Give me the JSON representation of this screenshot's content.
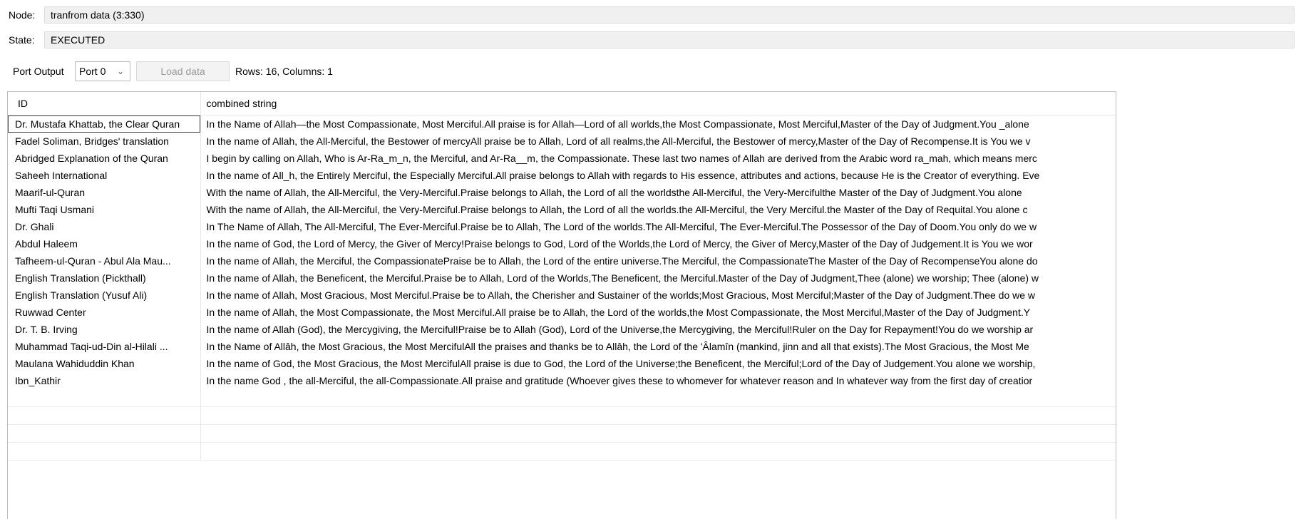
{
  "node": {
    "label": "Node:",
    "value": "tranfrom data  (3:330)"
  },
  "state": {
    "label": "State:",
    "value": "EXECUTED"
  },
  "toolbar": {
    "port_output_label": "Port Output",
    "port_selected": "Port 0",
    "load_button": "Load data",
    "rows_info": "Rows: 16, Columns: 1"
  },
  "table": {
    "headers": [
      "ID",
      "combined string"
    ],
    "rows": [
      {
        "id": "Dr. Mustafa Khattab, the Clear Quran",
        "text": "In the Name of Allah—the Most Compassionate, Most Merciful.All praise is for Allah—Lord of all worlds,the Most Compassionate, Most Merciful,Master of the Day of Judgment.You _alone"
      },
      {
        "id": "Fadel Soliman, Bridges' translation",
        "text": "In the name of Allah, the All-Merciful, the Bestower of mercyAll praise be to Allah, Lord of all realms,the All-Merciful, the Bestower of mercy,Master of the Day of Recompense.It is You we v"
      },
      {
        "id": "Abridged Explanation of the Quran",
        "text": "I begin by calling on Allah, Who is Ar-Ra_m_n, the Merciful, and Ar-Ra__m, the Compassionate. These last two names of Allah are derived from the Arabic word ra_mah, which means merc"
      },
      {
        "id": "Saheeh International",
        "text": "In the name of All_h, the Entirely Merciful, the Especially Merciful.All praise belongs to Allah with regards to His essence, attributes and actions, because He is the Creator of everything. Eve"
      },
      {
        "id": "Maarif-ul-Quran",
        "text": "With the name of Allah, the All-Merciful, the Very-Merciful.Praise belongs to Allah, the Lord of all the worldsthe All-Merciful, the Very-Mercifulthe Master of the Day of Judgment.You alone"
      },
      {
        "id": "Mufti Taqi Usmani",
        "text": "With the name of Allah, the All-Merciful, the Very-Merciful.Praise belongs to Allah, the Lord of all the worlds.the All-Merciful, the Very Merciful.the Master of the Day of Requital.You alone c"
      },
      {
        "id": "Dr. Ghali",
        "text": "In The Name of Allah, The All-Merciful, The Ever-Merciful.Praise be to Allah, The Lord of the worlds.The All-Merciful, The Ever-Merciful.The Possessor of the Day of Doom.You only do we w"
      },
      {
        "id": "Abdul Haleem",
        "text": "In the name of God, the Lord of Mercy, the Giver of Mercy!Praise belongs to God, Lord of the Worlds,the Lord of Mercy, the Giver of Mercy,Master of the Day of Judgement.It is You we wor"
      },
      {
        "id": "Tafheem-ul-Quran - Abul Ala Mau...",
        "text": "In the name of Allah, the Merciful, the CompassionatePraise be to Allah, the Lord of the entire universe.The Merciful, the CompassionateThe Master of the Day of RecompenseYou alone do"
      },
      {
        "id": "English Translation (Pickthall)",
        "text": "In the name of Allah, the Beneficent, the Merciful.Praise be to Allah, Lord of the Worlds,The Beneficent, the Merciful.Master of the Day of Judgment,Thee (alone) we worship; Thee (alone) w"
      },
      {
        "id": "English Translation (Yusuf Ali)",
        "text": "In the name of Allah, Most Gracious, Most Merciful.Praise be to Allah, the Cherisher and Sustainer of the worlds;Most Gracious, Most Merciful;Master of the Day of Judgment.Thee do we w"
      },
      {
        "id": "Ruwwad Center",
        "text": "In the name of Allah, the Most Compassionate, the Most Merciful.All praise be to Allah, the Lord of the worlds,the Most Compassionate, the Most Merciful,Master of the Day of Judgment.Y"
      },
      {
        "id": "Dr. T. B. Irving",
        "text": "In the name of Allah (God), the Mercygiving, the Merciful!Praise be to Allah (God), Lord of the Universe,the Mercygiving, the Merciful!Ruler on the Day for Repayment!You do we worship ar"
      },
      {
        "id": "Muhammad Taqi-ud-Din al-Hilali ...",
        "text": "In the Name of Allâh, the Most Gracious, the Most MercifulAll the praises and thanks be to Allâh, the Lord of the 'Âlamîn (mankind, jinn and all that exists).The Most Gracious, the Most Me"
      },
      {
        "id": "Maulana Wahiduddin Khan",
        "text": "In the name of God, the Most Gracious, the Most MercifulAll praise is due to God, the Lord of the Universe;the Beneficent, the Merciful;Lord of the Day of Judgement.You alone we worship,"
      },
      {
        "id": "Ibn_Kathir",
        "text": "In the name God , the all-Merciful, the all-Compassionate.All praise and gratitude (Whoever gives these to whomever for whatever reason and In whatever way from the first day of creatior"
      }
    ]
  }
}
